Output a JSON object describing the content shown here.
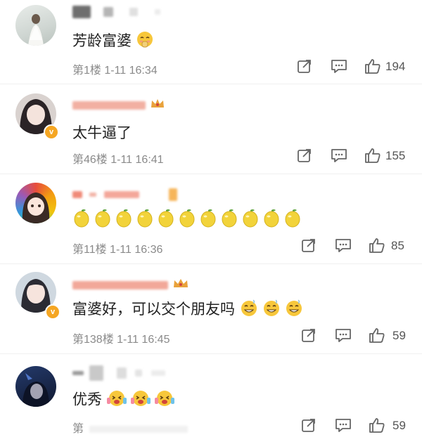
{
  "comments": [
    {
      "text": "芳龄富婆",
      "floor_time": "第1楼 1-11 16:34",
      "likes": "194",
      "emoji": "blush-fan",
      "emoji_count": 1
    },
    {
      "text": "太牛逼了",
      "floor_time": "第46楼 1-11 16:41",
      "likes": "155",
      "emoji_count": 0
    },
    {
      "text": "",
      "floor_time": "第11楼 1-11 16:36",
      "likes": "85",
      "emoji": "lemon",
      "emoji_count": 11
    },
    {
      "text": "富婆好，可以交个朋友吗",
      "floor_time": "第138楼 1-11 16:45",
      "likes": "59",
      "emoji": "drooling-face",
      "emoji_count": 3
    },
    {
      "text": "优秀",
      "floor_time": "第",
      "likes": "59",
      "emoji": "cheering-face",
      "emoji_count": 3
    }
  ],
  "icons": {
    "share": "share-icon",
    "reply": "reply-icon",
    "like": "thumbs-up-icon"
  },
  "colors": {
    "verified_badge": "#f5a623",
    "crown": "#e9a23b",
    "lemon": "#f2d33a"
  }
}
